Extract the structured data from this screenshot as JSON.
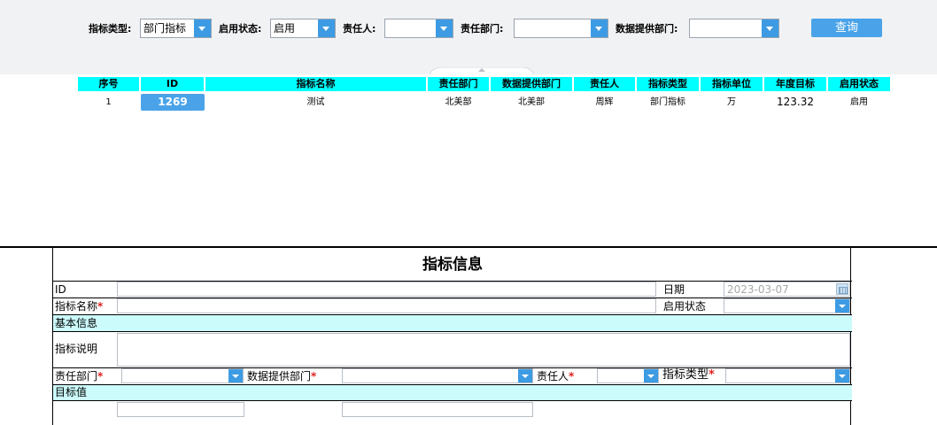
{
  "filters": {
    "type_label": "指标类型:",
    "type_value": "部门指标",
    "status_label": "启用状态:",
    "status_value": "启用",
    "owner_label": "责任人:",
    "owner_value": "",
    "dept_label": "责任部门:",
    "dept_value": "",
    "provider_label": "数据提供部门:",
    "provider_value": "",
    "query_button": "查询"
  },
  "table": {
    "columns": [
      "序号",
      "ID",
      "指标名称",
      "责任部门",
      "数据提供部门",
      "责任人",
      "指标类型",
      "指标单位",
      "年度目标",
      "启用状态"
    ],
    "rows": [
      [
        "1",
        "1269",
        "测试",
        "北美部",
        "北美部",
        "周辉",
        "部门指标",
        "万",
        "123.32",
        "启用"
      ]
    ]
  },
  "form": {
    "title": "指标信息",
    "id_label": "ID",
    "id_value": "",
    "date_label": "日期",
    "date_value": "2023-03-07",
    "name_label": "指标名称",
    "name_value": "",
    "status_label": "启用状态",
    "status_value": "",
    "section_basic": "基本信息",
    "desc_label": "指标说明",
    "desc_value": "",
    "dept_label": "责任部门",
    "dept_value": "",
    "provider_label": "数据提供部门",
    "provider_value": "",
    "owner_label": "责任人",
    "owner_value": "",
    "type_label": "指标类型",
    "type_value": "",
    "section_target": "目标值",
    "required_mark": "*"
  },
  "colors": {
    "header_bg": "#00ffff",
    "accent": "#4aa3e8",
    "section_bg": "#ccfbfb",
    "required": "#e02020",
    "placeholder_date": "#a8a8a8"
  },
  "icons": [
    "chevron-down-icon",
    "calendar-icon"
  ]
}
